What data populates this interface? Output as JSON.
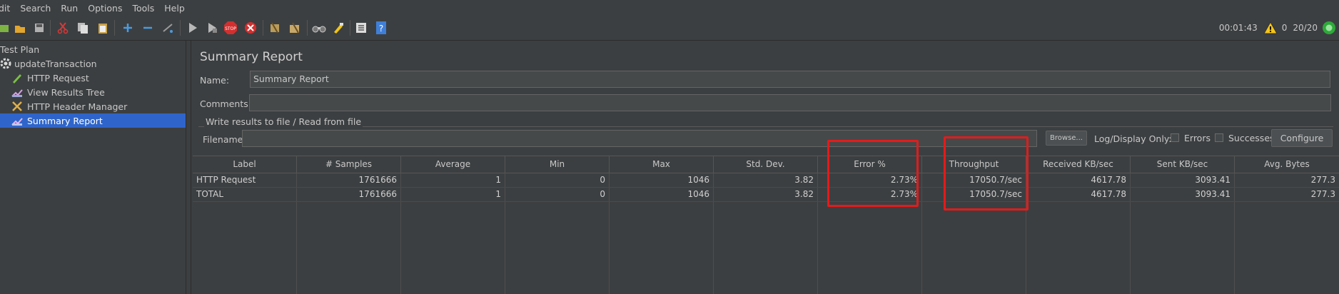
{
  "menu": [
    "dit",
    "Search",
    "Run",
    "Options",
    "Tools",
    "Help"
  ],
  "toolbar_icons": [
    "open-icon",
    "templates-icon",
    "save-icon",
    "cut-icon",
    "copy-icon",
    "paste-icon",
    "expand-icon",
    "collapse-icon",
    "toggle-icon",
    "start-icon",
    "start-no-pause-icon",
    "stop-icon",
    "shutdown-icon",
    "clear-icon",
    "clear-all-icon",
    "search-icon",
    "reset-search-icon",
    "function-helper-icon",
    "help-icon"
  ],
  "status": {
    "elapsed": "00:01:43",
    "warnings": "0",
    "threads": "20/20"
  },
  "tree": [
    {
      "label": "Test Plan"
    },
    {
      "label": "updateTransaction"
    },
    {
      "label": "HTTP Request"
    },
    {
      "label": "View Results Tree"
    },
    {
      "label": "HTTP Header Manager"
    },
    {
      "label": "Summary Report"
    }
  ],
  "panel": {
    "title": "Summary Report",
    "name_label": "Name:",
    "name_value": "Summary Report",
    "comments_label": "Comments:",
    "comments_value": "",
    "group_label": "Write results to file / Read from file",
    "filename_label": "Filename",
    "filename_value": "",
    "browse_label": "Browse...",
    "log_display_label": "Log/Display Only:",
    "errors_label": "Errors",
    "successes_label": "Successes",
    "configure_label": "Configure"
  },
  "table": {
    "headers": [
      "Label",
      "# Samples",
      "Average",
      "Min",
      "Max",
      "Std. Dev.",
      "Error %",
      "Throughput",
      "Received KB/sec",
      "Sent KB/sec",
      "Avg. Bytes"
    ],
    "rows": [
      [
        "HTTP Request",
        "1761666",
        "1",
        "0",
        "1046",
        "3.82",
        "2.73%",
        "17050.7/sec",
        "4617.78",
        "3093.41",
        "277.3"
      ],
      [
        "TOTAL",
        "1761666",
        "1",
        "0",
        "1046",
        "3.82",
        "2.73%",
        "17050.7/sec",
        "4617.78",
        "3093.41",
        "277.3"
      ]
    ]
  },
  "colors": {
    "highlight": "#e41b1b",
    "selection": "#2f65ca",
    "background": "#3c3f41"
  }
}
